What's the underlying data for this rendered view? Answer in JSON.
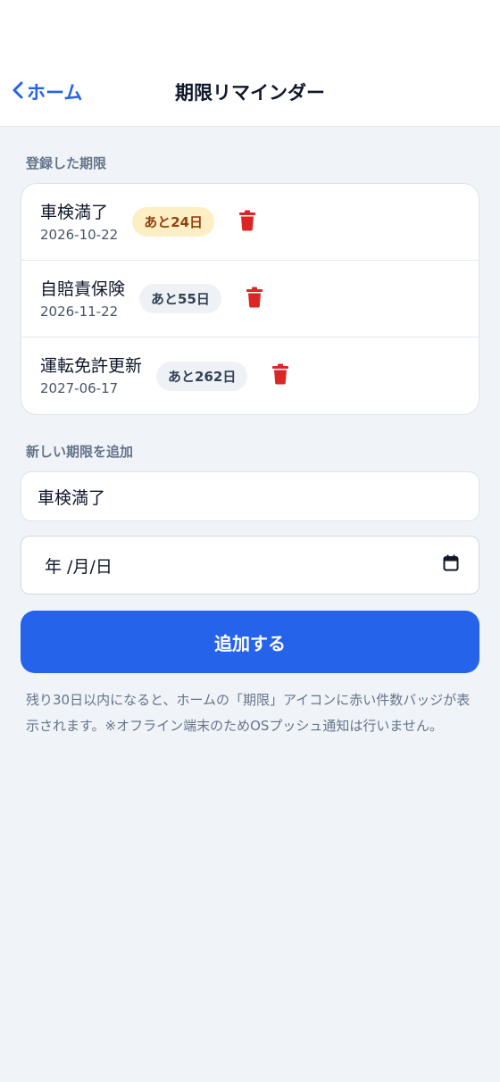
{
  "nav": {
    "back_label": "ホーム",
    "title": "期限リマインダー"
  },
  "registered": {
    "section_label": "登録した期限",
    "items": [
      {
        "name": "車検満了",
        "date": "2026-10-22",
        "badge": "あと24日",
        "badge_style": "warning"
      },
      {
        "name": "自賠責保険",
        "date": "2026-11-22",
        "badge": "あと55日",
        "badge_style": "normal"
      },
      {
        "name": "運転免許更新",
        "date": "2027-06-17",
        "badge": "あと262日",
        "badge_style": "normal"
      }
    ]
  },
  "add_form": {
    "section_label": "新しい期限を追加",
    "name_value": "車検満了",
    "date_placeholder": "年 /月/日",
    "submit_label": "追加する"
  },
  "note": "残り30日以内になると、ホームの「期限」アイコンに赤い件数バッジが表示されます。※オフライン端末のためOSプッシュ通知は行いません。",
  "colors": {
    "accent": "#2563eb",
    "danger": "#dc2626",
    "warning_badge_bg": "#fdefc4",
    "warning_badge_text": "#92400e",
    "background": "#f0f4f8"
  },
  "icons": {
    "back": "chevron-left-icon",
    "delete": "trash-icon",
    "calendar": "calendar-icon"
  }
}
